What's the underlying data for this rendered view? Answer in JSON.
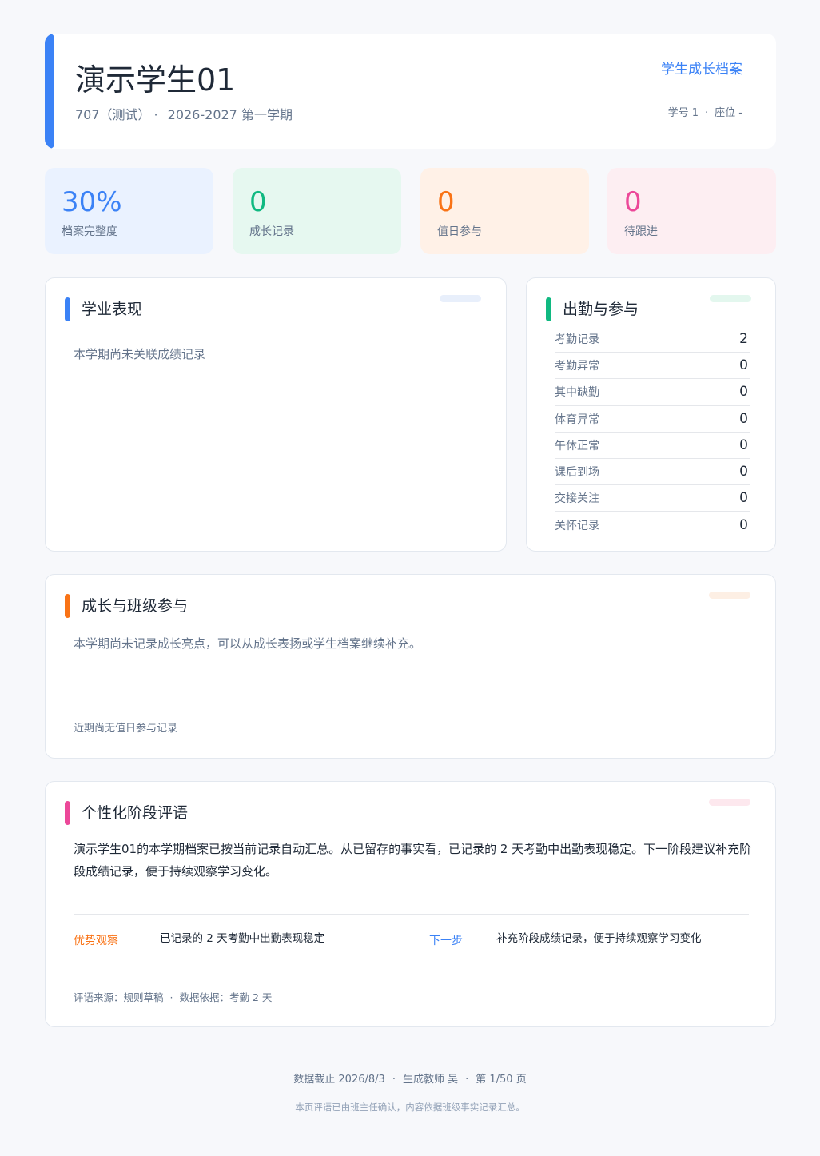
{
  "header": {
    "name": "演示学生01",
    "class_name": "707（测试）",
    "term": "2026-2027 第一学期",
    "archive_link": "学生成长档案",
    "student_no": "学号 1",
    "seat": "座位 -",
    "accent_color": "#3b82f6"
  },
  "stats": [
    {
      "value": "30%",
      "label": "档案完整度",
      "color": "#3b82f6"
    },
    {
      "value": "0",
      "label": "成长记录",
      "color": "#10b981"
    },
    {
      "value": "0",
      "label": "值日参与",
      "color": "#f97316"
    },
    {
      "value": "0",
      "label": "待跟进",
      "color": "#ec4899"
    }
  ],
  "academic": {
    "title": "学业表现",
    "empty_text": "本学期尚未关联成绩记录"
  },
  "attendance": {
    "title": "出勤与参与",
    "rows": [
      {
        "label": "考勤记录",
        "value": "2"
      },
      {
        "label": "考勤异常",
        "value": "0"
      },
      {
        "label": "其中缺勤",
        "value": "0"
      },
      {
        "label": "体育异常",
        "value": "0"
      },
      {
        "label": "午休正常",
        "value": "0"
      },
      {
        "label": "课后到场",
        "value": "0"
      },
      {
        "label": "交接关注",
        "value": "0"
      },
      {
        "label": "关怀记录",
        "value": "0"
      }
    ]
  },
  "growth": {
    "title": "成长与班级参与",
    "empty_text": "本学期尚未记录成长亮点，可以从成长表扬或学生档案继续补充。",
    "duty_empty": "近期尚无值日参与记录"
  },
  "comment": {
    "title": "个性化阶段评语",
    "text": "演示学生01的本学期档案已按当前记录自动汇总。从已留存的事实看，已记录的 2 天考勤中出勤表现稳定。下一阶段建议补充阶段成绩记录，便于持续观察学习变化。",
    "strength_label": "优势观察",
    "strength_text": "已记录的 2 天考勤中出勤表现稳定",
    "next_label": "下一步",
    "next_text": "补充阶段成绩记录，便于持续观察学习变化",
    "source": "评语来源：规则草稿",
    "basis": "数据依据：考勤 2 天"
  },
  "footer": {
    "cutoff": "数据截止 2026/8/3",
    "teacher": "生成教师 吴",
    "page": "第 1/50 页",
    "note": "本页评语已由班主任确认，内容依据班级事实记录汇总。"
  }
}
